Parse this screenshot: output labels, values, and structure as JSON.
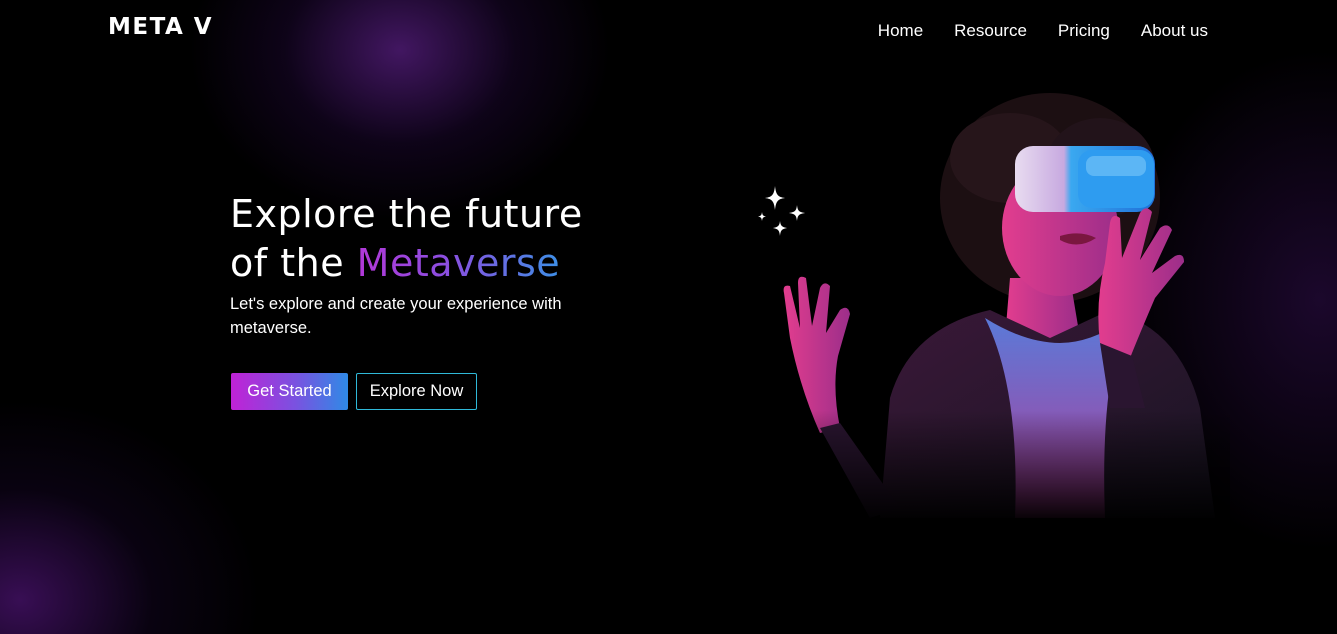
{
  "brand": {
    "logo": "META V"
  },
  "nav": {
    "items": [
      {
        "label": "Home"
      },
      {
        "label": "Resource"
      },
      {
        "label": "Pricing"
      },
      {
        "label": "About us"
      }
    ]
  },
  "hero": {
    "title_line1": "Explore the future",
    "title_line2_prefix": "of the ",
    "title_line2_accent": "Metaverse",
    "subtitle": "Let's explore and create your experience with metaverse.",
    "primary_button": "Get Started",
    "secondary_button": "Explore Now"
  },
  "icons": {
    "sparkles": "sparkles-icon",
    "hero_image": "vr-headset-person-image"
  },
  "colors": {
    "background": "#000000",
    "accent_purple": "#c022d6",
    "accent_blue": "#2f8ae6",
    "outline_cyan": "#2fb9d8",
    "glow": "#581e82"
  }
}
